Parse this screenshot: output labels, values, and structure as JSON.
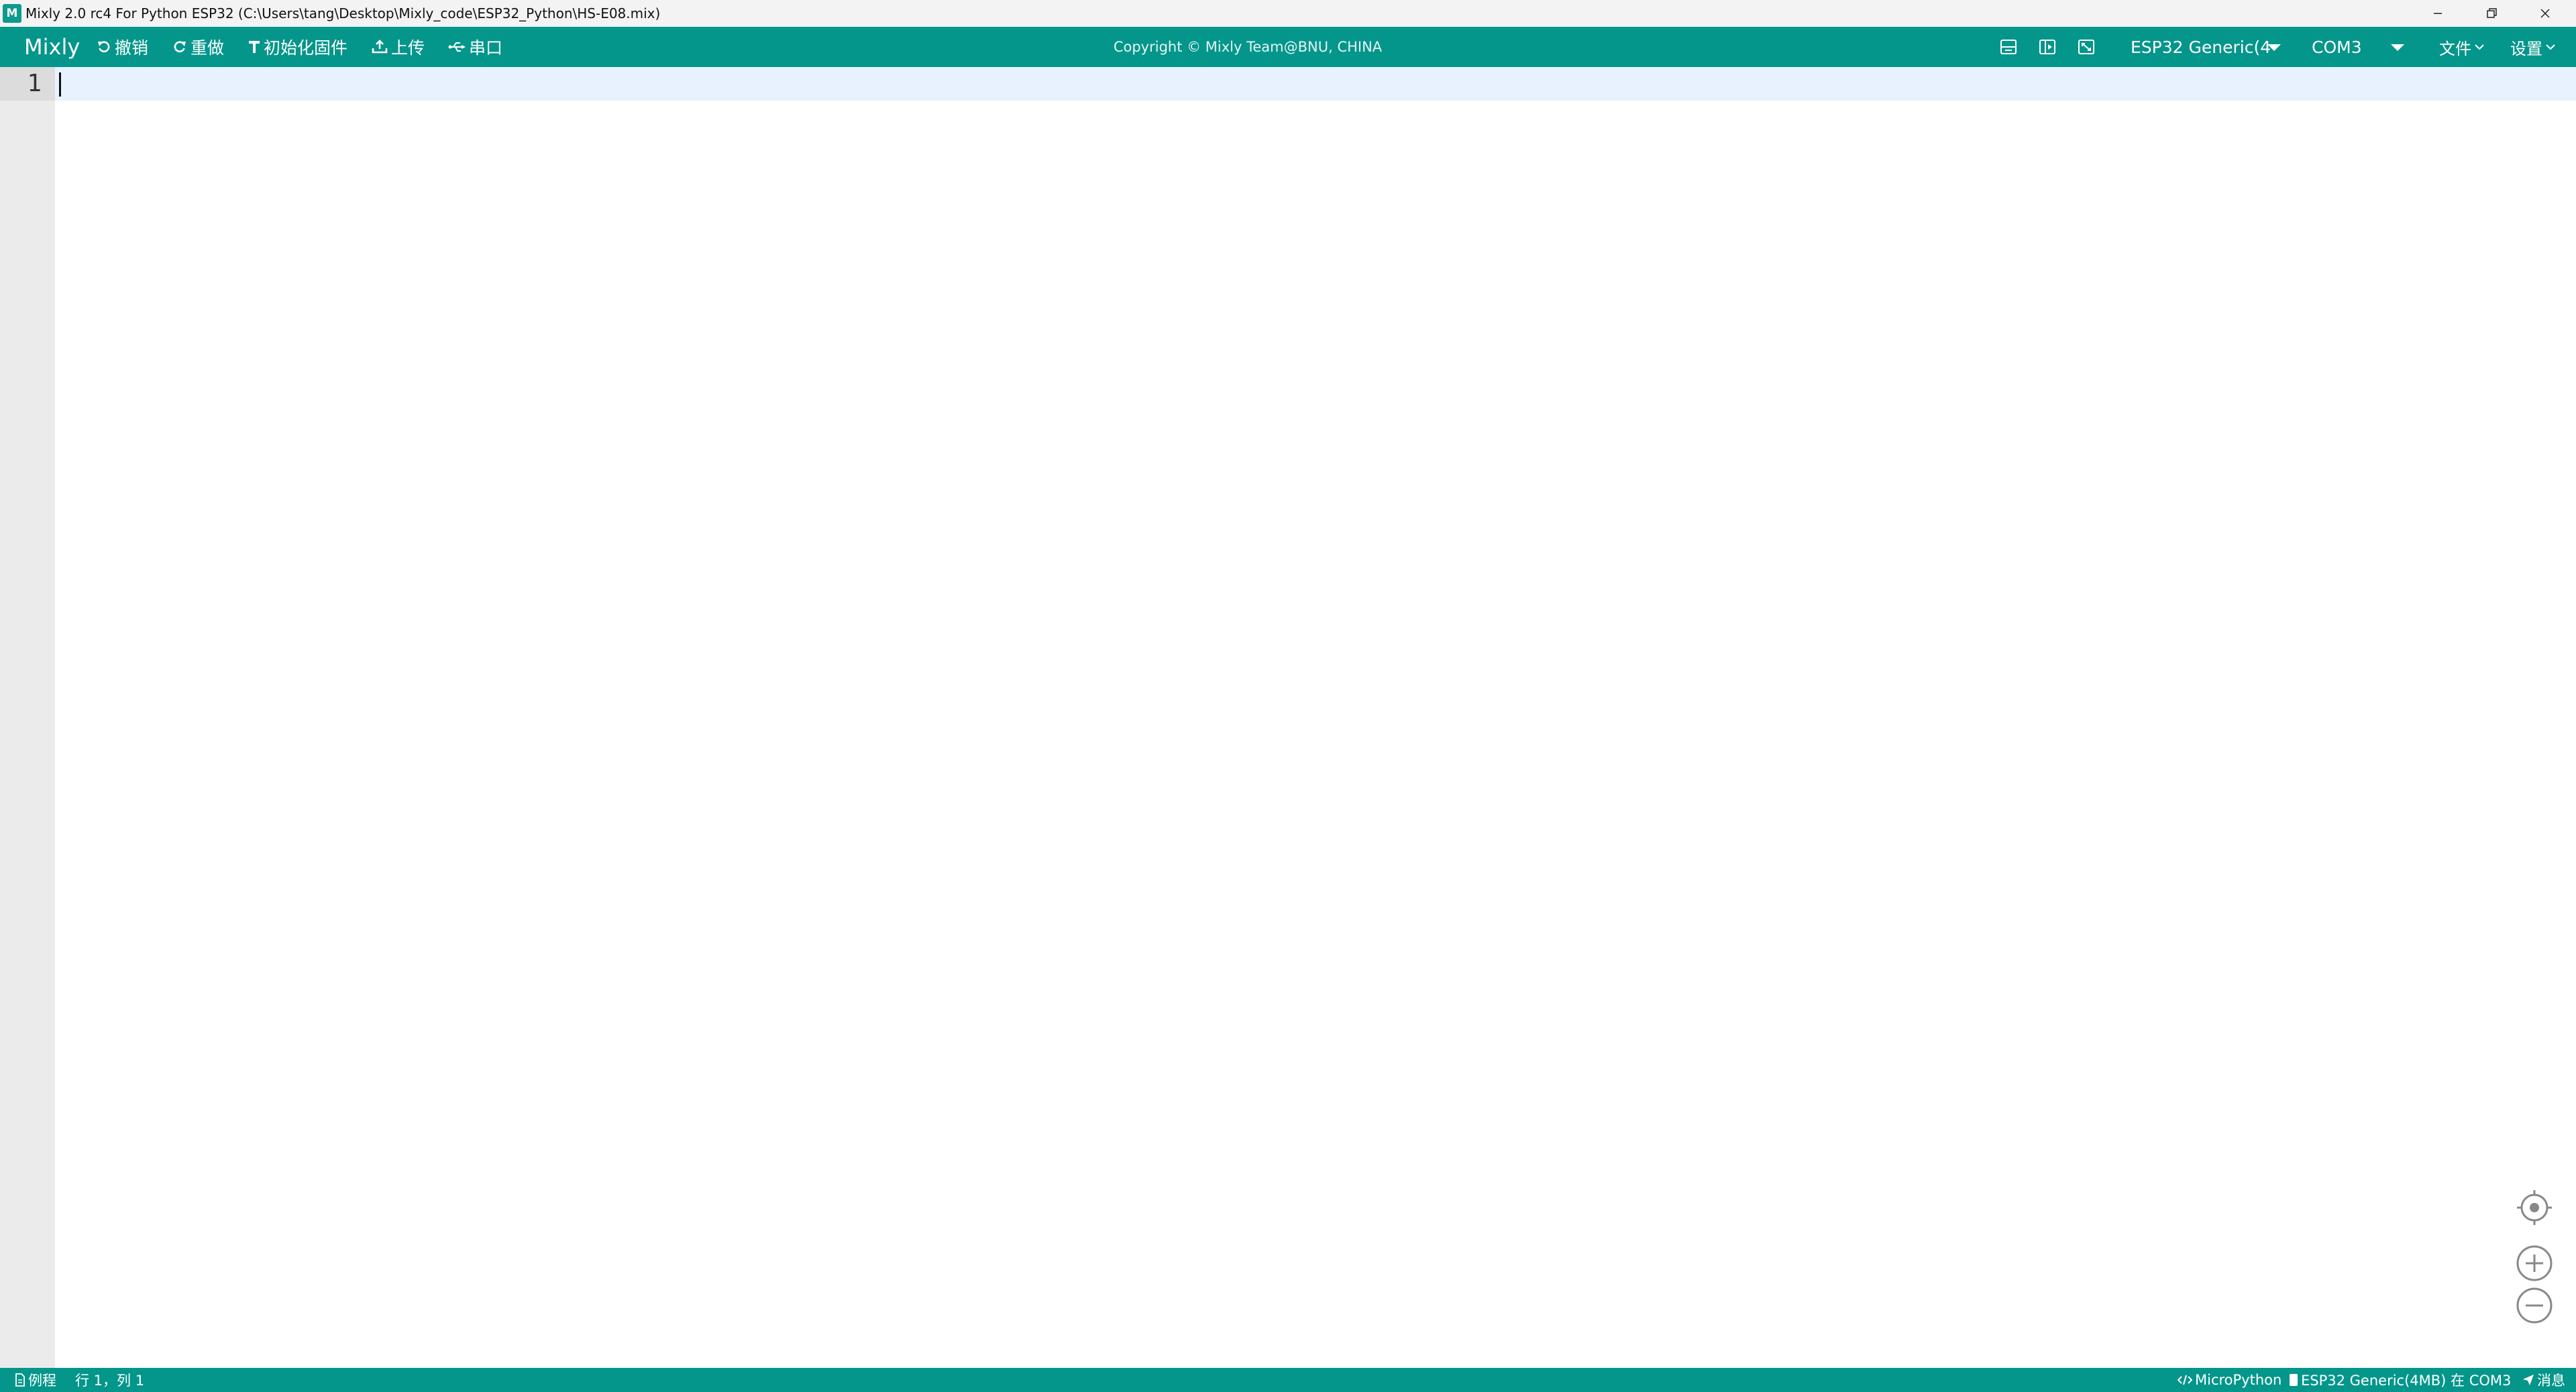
{
  "window": {
    "title": "Mixly 2.0 rc4 For Python ESP32 (C:\\Users\\tang\\Desktop\\Mixly_code\\ESP32_Python\\HS-E08.mix)",
    "app_icon_text": "M",
    "controls": [
      "minimize-icon",
      "restore-icon",
      "close-icon"
    ]
  },
  "toolbar": {
    "brand": "Mixly",
    "undo_label": "撤销",
    "redo_label": "重做",
    "init_firmware_label": "初始化固件",
    "upload_label": "上传",
    "serial_label": "串口",
    "copyright": "Copyright © Mixly Team@BNU, CHINA",
    "board_select": "ESP32 Generic(4",
    "port_select": "COM3",
    "file_menu": "文件",
    "settings_menu": "设置",
    "view_icons": [
      "code-view-icon",
      "split-view-icon",
      "fullscreen-icon"
    ]
  },
  "editor": {
    "line_numbers": [
      "1"
    ],
    "content": ""
  },
  "statusbar": {
    "examples_label": "例程",
    "cursor_position": "行 1，列 1",
    "language": "MicroPython",
    "board_info": "ESP32 Generic(4MB) 在 COM3",
    "messages_label": "消息"
  },
  "colors": {
    "accent": "#05968b",
    "gutter": "#ebebeb",
    "active_line": "#e8f2fe"
  }
}
